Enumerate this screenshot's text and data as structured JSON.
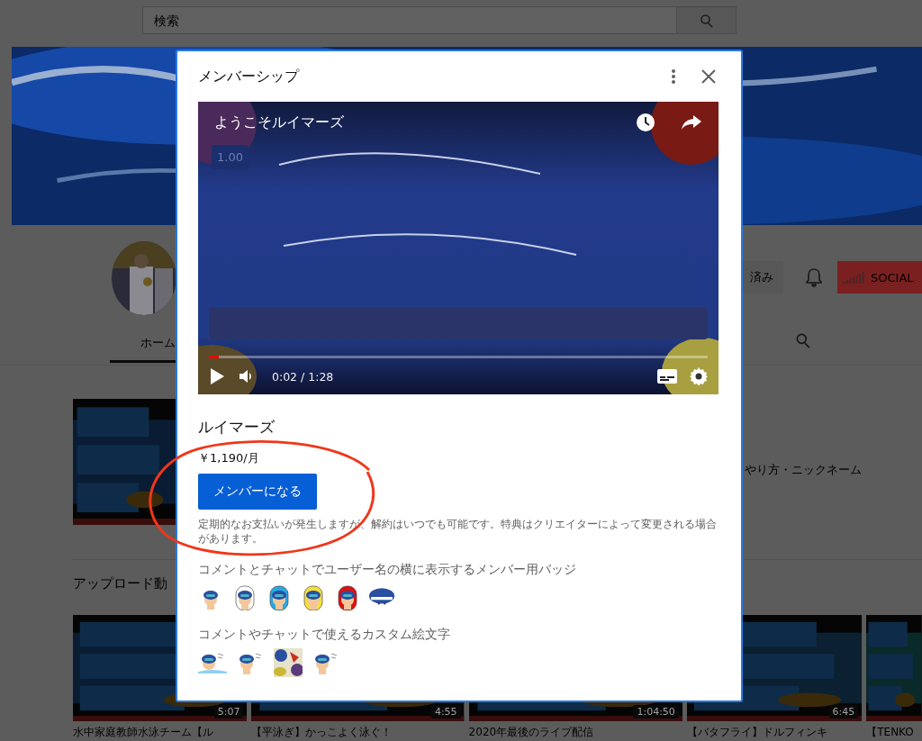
{
  "search": {
    "placeholder": "検索"
  },
  "channel_header": {
    "tabs": [
      {
        "label": "ホーム",
        "selected": true
      }
    ],
    "subscribe_button": "済み",
    "social_button": "SOCIAL"
  },
  "featured": {
    "description": "やり方・ニックネーム"
  },
  "uploads": {
    "heading": "アップロード動",
    "videos": [
      {
        "duration": "5:07",
        "title": "水中家庭教師水泳チーム【ル"
      },
      {
        "duration": "4:55",
        "title": "【平泳ぎ】かっこよく泳ぐ！"
      },
      {
        "duration": "1:04:50",
        "title": "2020年最後のライブ配信"
      },
      {
        "duration": "6:45",
        "title": "【バタフライ】ドルフィンキ"
      },
      {
        "title": "【TENKO"
      }
    ]
  },
  "dialog": {
    "title": "メンバーシップ",
    "player": {
      "title": "ようこそルイマーズ",
      "speed": "1.00",
      "time": "0:02 / 1:28",
      "level": 0.02
    },
    "channel_name": "ルイマーズ",
    "price": "￥1,190/月",
    "join_button": "メンバーになる",
    "disclaimer": "定期的なお支払いが発生しますが、解約はいつでも可能です。特典はクリエイターによって変更される場合があります。",
    "perks": [
      {
        "heading": "コメントとチャットでユーザー名の横に表示するメンバー用バッジ"
      },
      {
        "heading": "コメントやチャットで使えるカスタム絵文字"
      }
    ]
  }
}
